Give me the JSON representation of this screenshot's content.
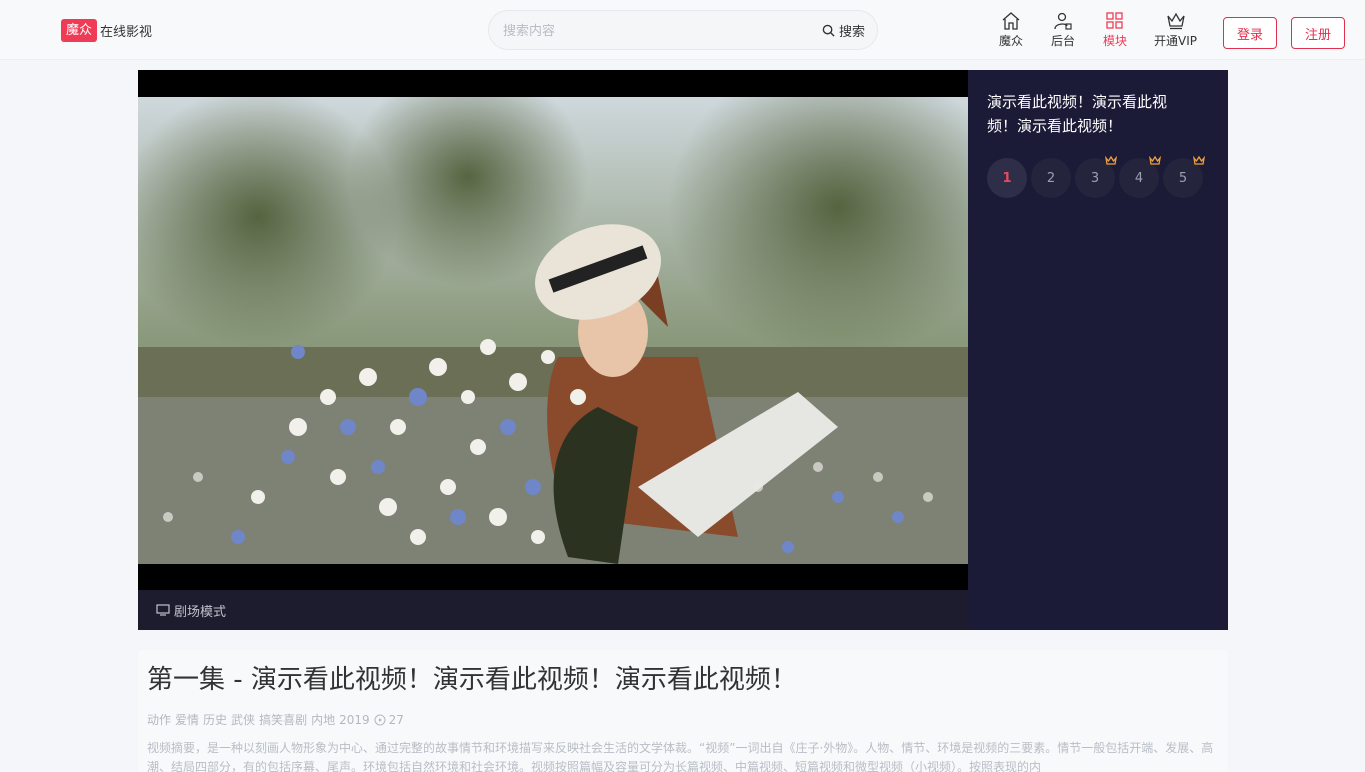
{
  "header": {
    "logo_badge": "魔众",
    "logo_text": "在线影视",
    "search_placeholder": "搜索内容",
    "search_button": "搜索",
    "nav": [
      {
        "label": "魔众",
        "icon": "home-icon"
      },
      {
        "label": "后台",
        "icon": "user-admin-icon"
      },
      {
        "label": "模块",
        "icon": "grid-icon",
        "active": true
      },
      {
        "label": "开通VIP",
        "icon": "crown-icon"
      }
    ],
    "login": "登录",
    "register": "注册"
  },
  "player": {
    "theater_mode": "剧场模式",
    "side_title": "演示看此视频！演示看此视频！演示看此视频！",
    "episodes": [
      {
        "num": "1",
        "active": true,
        "vip": false
      },
      {
        "num": "2",
        "active": false,
        "vip": false
      },
      {
        "num": "3",
        "active": false,
        "vip": true
      },
      {
        "num": "4",
        "active": false,
        "vip": true
      },
      {
        "num": "5",
        "active": false,
        "vip": true
      }
    ]
  },
  "info": {
    "title": "第一集 - 演示看此视频！演示看此视频！演示看此视频！",
    "tags": [
      "动作",
      "爱情",
      "历史",
      "武侠",
      "搞笑喜剧"
    ],
    "region": "内地",
    "year": "2019",
    "plays": "27",
    "desc": "视频摘要，是一种以刻画人物形象为中心、通过完整的故事情节和环境描写来反映社会生活的文学体裁。“视频”一词出自《庄子·外物》。人物、情节、环境是视频的三要素。情节一般包括开端、发展、高潮、结局四部分，有的包括序幕、尾声。环境包括自然环境和社会环境。视频按照篇幅及容量可分为长篇视频、中篇视频、短篇视频和微型视频（小视频）。按照表现的内"
  },
  "colors": {
    "accent": "#ef3b56",
    "sidebar_bg": "#1b1b38"
  }
}
